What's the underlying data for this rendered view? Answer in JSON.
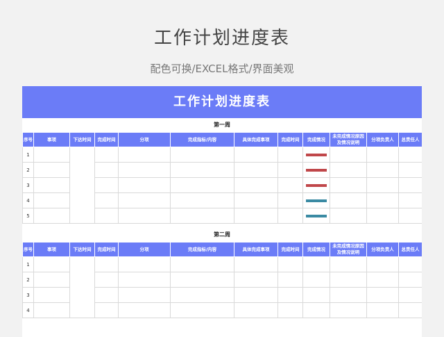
{
  "page": {
    "title": "工作计划进度表",
    "subtitle": "配色可换/EXCEL格式/界面美观"
  },
  "sheet": {
    "banner": "工作计划进度表",
    "headers": [
      "序号",
      "事项",
      "下达时间",
      "完成时间",
      "分项",
      "完成指标/内容",
      "具体完成事项",
      "完成时间",
      "完成情况",
      "未完成情况原因及情况说明",
      "分项负责人",
      "总责任人"
    ],
    "weeks": [
      {
        "title": "第一周",
        "rows": [
          "1",
          "2",
          "3",
          "4",
          "5"
        ],
        "status_colors": [
          "#c0474a",
          "#c0474a",
          "#c0474a",
          "#3a8aa3",
          "#3a8aa3"
        ]
      },
      {
        "title": "第二周",
        "rows": [
          "1",
          "2",
          "3",
          "4"
        ],
        "status_colors": [
          "",
          "",
          "",
          ""
        ]
      }
    ]
  }
}
